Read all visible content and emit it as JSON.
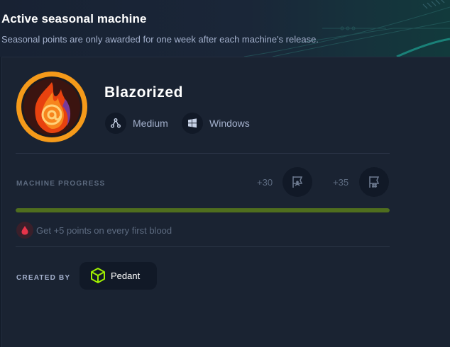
{
  "header": {
    "title": "Active seasonal machine",
    "subtitle": "Seasonal points are only awarded for one week after each machine's release."
  },
  "machine": {
    "name": "Blazorized",
    "difficulty": "Medium",
    "os": "Windows",
    "avatar_icon": "flame-at-sign-icon"
  },
  "progress": {
    "label": "MACHINE PROGRESS",
    "user_points": "+30",
    "root_points": "+35",
    "fraction": 1.0,
    "color": "#4f6e1e"
  },
  "first_blood": {
    "text": "Get +5 points on every first blood",
    "icon": "blood-drop-icon"
  },
  "creator": {
    "label": "CREATED BY",
    "name": "Pedant",
    "icon": "cube-icon"
  },
  "colors": {
    "background": "#141d2b",
    "card": "#1a2332",
    "accent_green": "#9fef00"
  }
}
